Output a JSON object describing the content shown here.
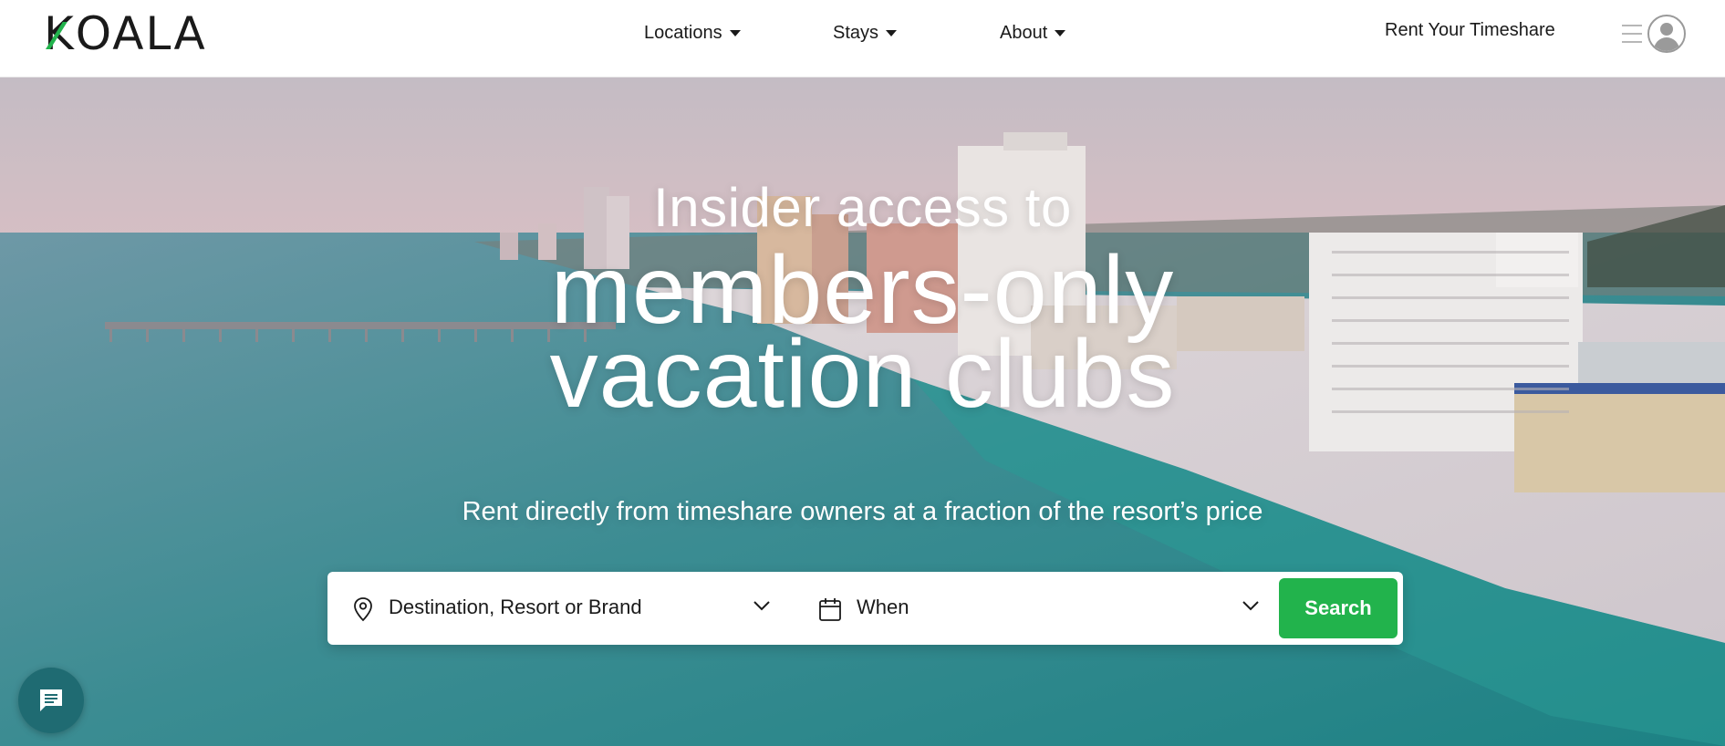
{
  "brand": {
    "name": "KOALA",
    "accent_color": "#22b34c"
  },
  "header": {
    "nav": [
      {
        "label": "Locations",
        "icon": "caret-down-icon"
      },
      {
        "label": "Stays",
        "icon": "caret-down-icon"
      },
      {
        "label": "About",
        "icon": "caret-down-icon"
      }
    ],
    "rent_link": "Rent Your Timeshare",
    "user_menu_icons": [
      "hamburger-icon",
      "user-avatar-icon"
    ]
  },
  "hero": {
    "line1": "Insider access to",
    "line2": "members-only",
    "line3": "vacation clubs",
    "subtitle": "Rent directly from timeshare owners at a fraction of the resort’s price",
    "background": "aerial beach with hotels at dusk"
  },
  "search": {
    "destination_placeholder": "Destination, Resort or Brand",
    "destination_icon": "map-pin-icon",
    "when_placeholder": "When",
    "when_icon": "calendar-icon",
    "button_label": "Search",
    "button_color": "#22b34c"
  },
  "chat": {
    "icon": "chat-icon",
    "color": "#1f6b72"
  }
}
